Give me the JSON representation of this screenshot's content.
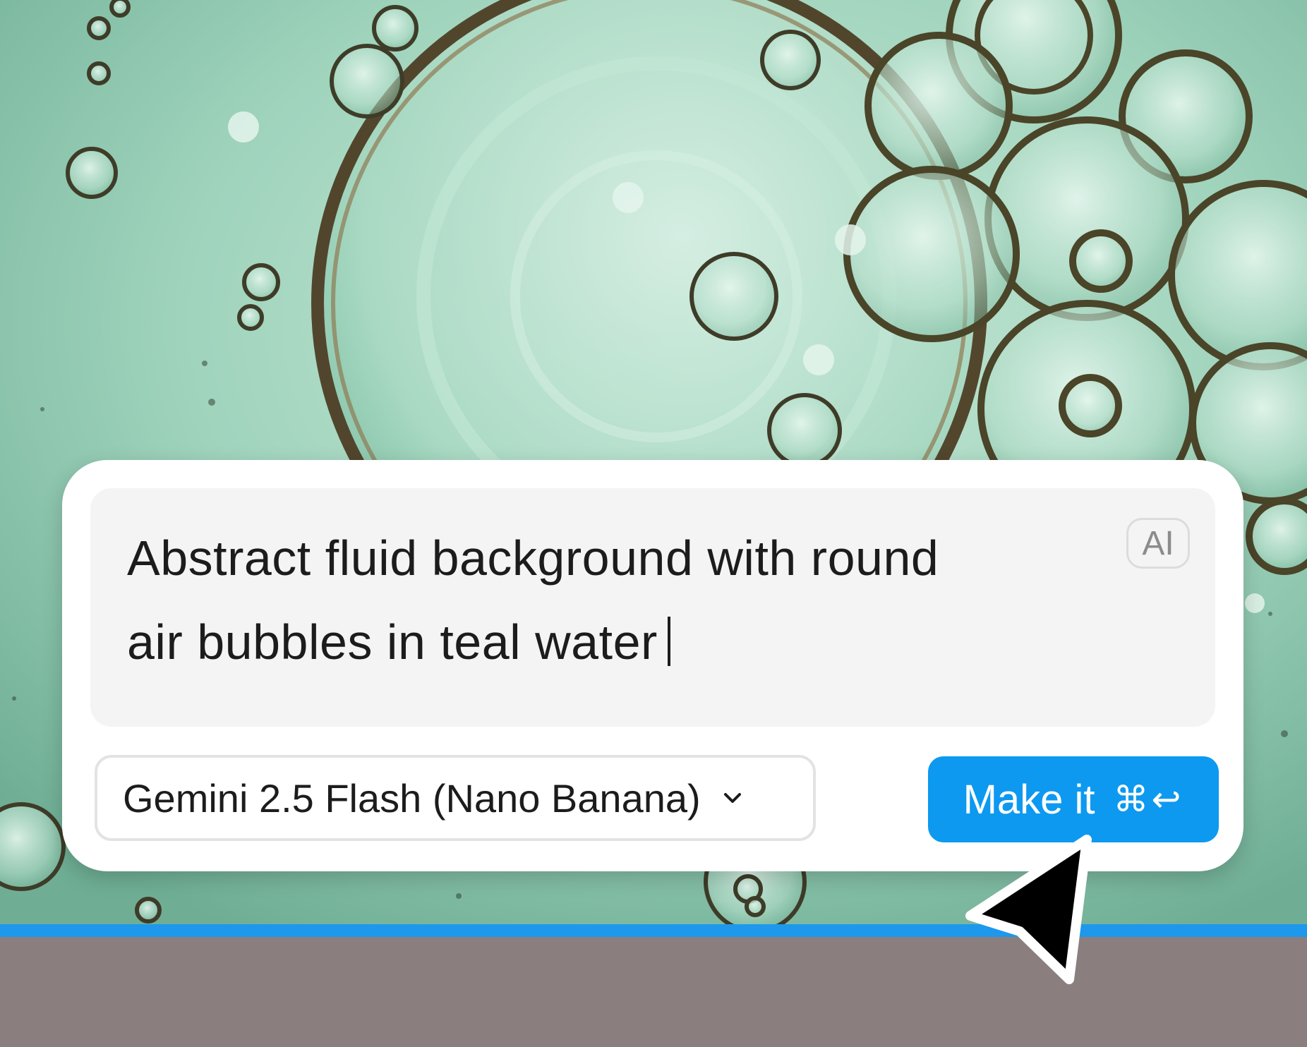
{
  "prompt": {
    "line1": "Abstract fluid background with round",
    "line2": "air bubbles in teal water"
  },
  "badge": {
    "label": "AI"
  },
  "model_select": {
    "selected": "Gemini 2.5 Flash (Nano Banana)",
    "icon": "chevron-down-icon"
  },
  "make_button": {
    "label": "Make it",
    "shortcut": "⌘↩"
  },
  "colors": {
    "accent": "#0d99f0",
    "selection_line": "#1d98ec",
    "bottom_area": "#8a7e7f",
    "canvas_teal": "#9ed4bd"
  }
}
